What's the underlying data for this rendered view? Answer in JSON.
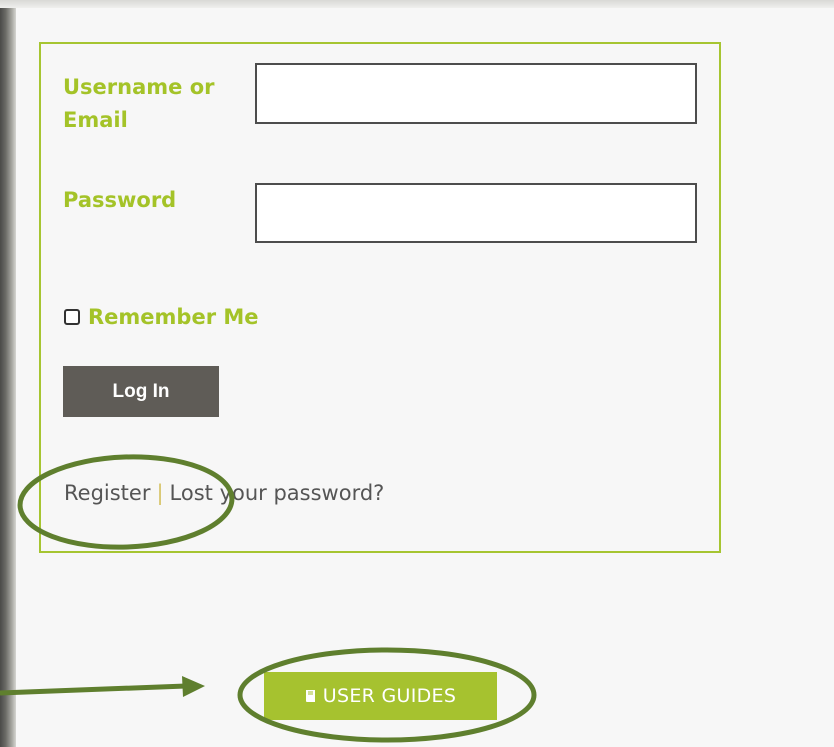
{
  "login_form": {
    "username_label": "Username or Email",
    "username_value": "",
    "password_label": "Password",
    "password_value": "",
    "remember_label": "Remember Me",
    "remember_checked": false,
    "login_button_label": "Log In",
    "register_link": "Register",
    "separator": "|",
    "lost_password_link": "Lost your password?"
  },
  "user_guides": {
    "label": "USER GUIDES",
    "icon": "book-icon"
  },
  "colors": {
    "accent_green": "#a4c328",
    "button_gray": "#5f5c57",
    "annotation_green": "#5f7f2e",
    "text_gray": "#555555"
  }
}
